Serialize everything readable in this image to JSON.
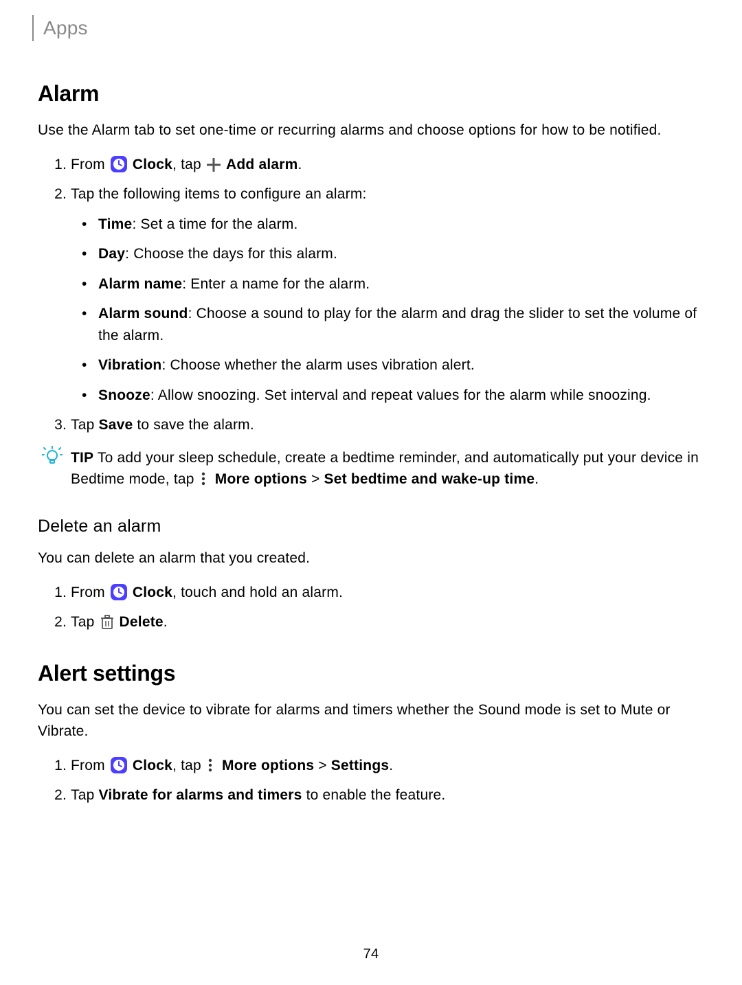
{
  "header": {
    "breadcrumb": "Apps"
  },
  "section_alarm": {
    "title": "Alarm",
    "intro": "Use the Alarm tab to set one-time or recurring alarms and choose options for how to be notified.",
    "step1_prefix": "From ",
    "step1_clock": "Clock",
    "step1_mid": ", tap ",
    "step1_addalarm": "Add alarm",
    "step1_suffix": ".",
    "step2": "Tap the following items to configure an alarm:",
    "bullets": {
      "time_l": "Time",
      "time_t": ": Set a time for the alarm.",
      "day_l": "Day",
      "day_t": ": Choose the days for this alarm.",
      "name_l": "Alarm name",
      "name_t": ": Enter a name for the alarm.",
      "sound_l": "Alarm sound",
      "sound_t": ": Choose a sound to play for the alarm and drag the slider to set the volume of the alarm.",
      "vib_l": "Vibration",
      "vib_t": ": Choose whether the alarm uses vibration alert.",
      "snooze_l": "Snooze",
      "snooze_t": ": Allow snoozing. Set interval and repeat values for the alarm while snoozing."
    },
    "step3_prefix": "Tap ",
    "step3_save": "Save",
    "step3_suffix": " to save the alarm."
  },
  "tip": {
    "label": "TIP",
    "text1": "  To add your sleep schedule, create a bedtime reminder, and automatically put your device in Bedtime mode, tap ",
    "more_options": "More options",
    "sep": " > ",
    "bedtime": "Set bedtime and wake-up time",
    "suffix": "."
  },
  "delete": {
    "title": "Delete an alarm",
    "intro": "You can delete an alarm that you created.",
    "step1_prefix": "From ",
    "step1_clock": "Clock",
    "step1_suffix": ", touch and hold an alarm.",
    "step2_prefix": "Tap ",
    "step2_delete": "Delete",
    "step2_suffix": "."
  },
  "alert": {
    "title": "Alert settings",
    "intro": "You can set the device to vibrate for alarms and timers whether the Sound mode is set to Mute or Vibrate.",
    "step1_prefix": "From ",
    "step1_clock": "Clock",
    "step1_mid": ", tap ",
    "step1_more": "More options",
    "step1_sep": " > ",
    "step1_settings": "Settings",
    "step1_suffix": ".",
    "step2_prefix": "Tap ",
    "step2_vibrate": "Vibrate for alarms and timers",
    "step2_suffix": " to enable the feature."
  },
  "page_number": "74"
}
